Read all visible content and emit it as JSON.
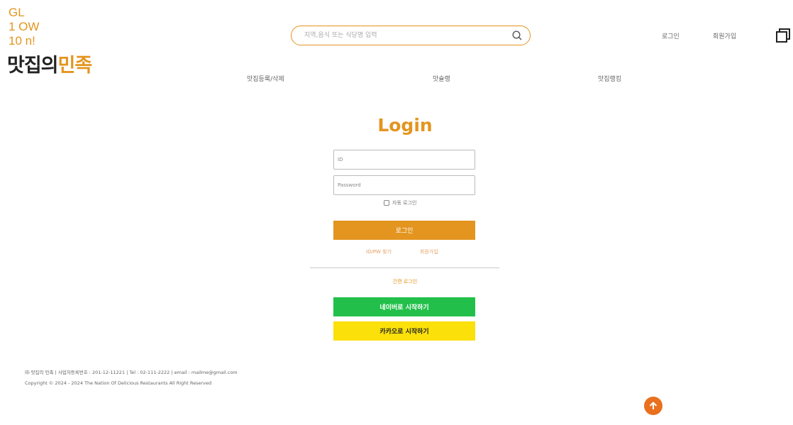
{
  "logo": {
    "deco_lines": [
      "GL",
      "1 OW",
      "10 n!"
    ],
    "name_part1": "맛집의",
    "name_part2": "민족"
  },
  "search": {
    "placeholder": "지역,음식 또는 식당명 입력"
  },
  "header": {
    "login_label": "로그인",
    "signup_label": "회원가입"
  },
  "gnb": {
    "items": [
      {
        "label": "맛집등록/삭제"
      },
      {
        "label": "맛슐랭"
      },
      {
        "label": "맛집랭킹"
      }
    ]
  },
  "login_form": {
    "title": "Login",
    "id_placeholder": "ID",
    "password_placeholder": "Password",
    "auto_login_label": "자동 로그인",
    "submit_label": "로그인",
    "find_label": "ID/PW 찾기",
    "join_label": "회원가입",
    "easy_login_label": "간편 로그인",
    "naver_label": "네이버로 시작하기",
    "kakao_label": "카카오로 시작하기"
  },
  "footer": {
    "line1": "㈜ 맛집의 민족 | 사업자등록번호 : 201-12-11221 | Tel : 02-111-2222 | email : mailme@gmail.com",
    "line2": "Copyright © 2024 - 2024 The Nation Of Delicious Restaurants All Right Reserved"
  },
  "colors": {
    "accent": "#e3951f",
    "naver": "#22c04a",
    "kakao": "#fbe00a",
    "top_button": "#e8701e"
  }
}
